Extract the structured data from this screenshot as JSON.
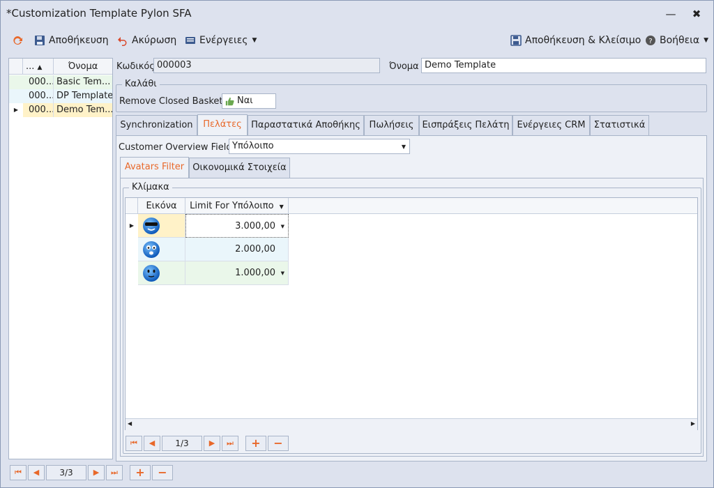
{
  "window": {
    "title": "*Customization Template Pylon SFA",
    "minimize": "—",
    "close": "✖"
  },
  "toolbar": {
    "refresh_icon": "refresh-icon",
    "save": "Αποθήκευση",
    "cancel": "Ακύρωση",
    "actions": "Ενέργειες",
    "save_close": "Αποθήκευση & Κλείσιμο",
    "help": "Βοήθεια"
  },
  "left_grid": {
    "headers": [
      "...",
      "Όνομα"
    ],
    "rows": [
      {
        "code": "000...",
        "name": "Basic Tem..."
      },
      {
        "code": "000...",
        "name": "DP Template"
      },
      {
        "code": "000...",
        "name": "Demo Tem..."
      }
    ],
    "selected_index": 2
  },
  "form": {
    "code_label": "Κωδικός",
    "code_value": "000003",
    "name_label": "Όνομα",
    "name_value": "Demo Template",
    "basket_group": "Καλάθι",
    "remove_baskets_label": "Remove Closed Baskets",
    "remove_baskets_value": "Ναι"
  },
  "tabs": [
    {
      "label": "Synchronization"
    },
    {
      "label": "Πελάτες"
    },
    {
      "label": "Παραστατικά Αποθήκης"
    },
    {
      "label": "Πωλήσεις"
    },
    {
      "label": "Εισπράξεις Πελάτη"
    },
    {
      "label": "Ενέργειες CRM"
    },
    {
      "label": "Στατιστικά"
    }
  ],
  "customers": {
    "overview_label": "Customer Overview Field",
    "overview_value": "Υπόλοιπο",
    "subtabs": [
      {
        "label": "Avatars Filter"
      },
      {
        "label": "Οικονομικά Στοιχεία"
      }
    ],
    "scale_group": "Κλίμακα",
    "grid_headers": [
      "Εικόνα",
      "Limit For Υπόλοιπο"
    ],
    "grid_rows": [
      {
        "avatar": "cool-smiley-icon",
        "limit": "3.000,00"
      },
      {
        "avatar": "surprised-smiley-icon",
        "limit": "2.000,00"
      },
      {
        "avatar": "plain-smiley-icon",
        "limit": "1.000,00"
      }
    ],
    "pager": "1/3"
  },
  "bottom_pager": "3/3",
  "colors": {
    "accent": "#e8682a",
    "row_selected": "#fff2c8",
    "row_even": "#eaf7ea",
    "row_odd": "#eaf6fb"
  }
}
